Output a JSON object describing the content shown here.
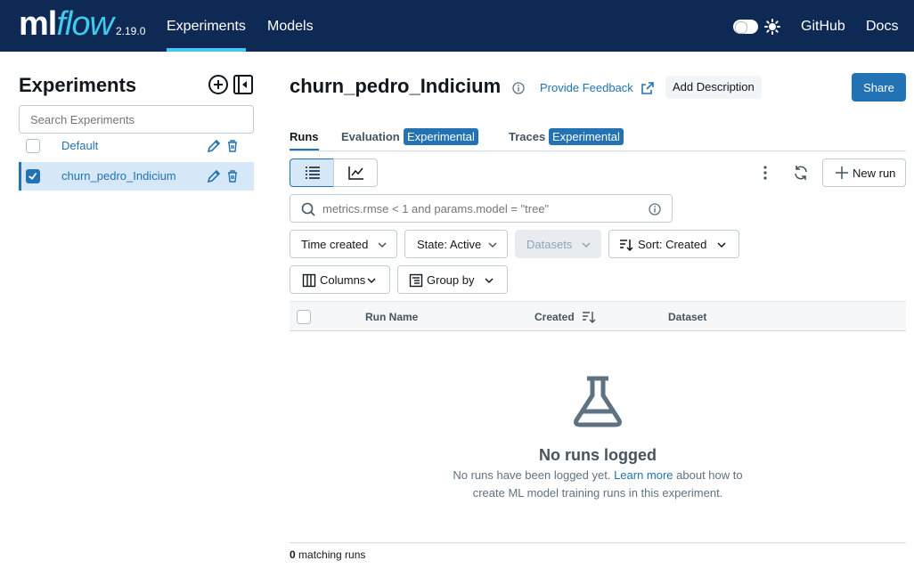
{
  "topbar": {
    "logo_ml": "ml",
    "logo_flow": "flow",
    "version": "2.19.0",
    "tabs": [
      {
        "label": "Experiments"
      },
      {
        "label": "Models"
      }
    ],
    "links": [
      {
        "label": "GitHub"
      },
      {
        "label": "Docs"
      }
    ],
    "bg_color": "#0e2a54",
    "accent_color": "#43c9ed"
  },
  "sidebar": {
    "title": "Experiments",
    "search_placeholder": "Search Experiments",
    "items": [
      {
        "label": "Default",
        "checked": false
      },
      {
        "label": "churn_pedro_Indicium",
        "checked": true
      }
    ]
  },
  "header": {
    "title": "churn_pedro_Indicium",
    "feedback_label": "Provide Feedback",
    "add_description_label": "Add Description",
    "share_label": "Share"
  },
  "tabs": [
    {
      "label": "Runs",
      "badge": ""
    },
    {
      "label": "Evaluation",
      "badge": "Experimental"
    },
    {
      "label": "Traces",
      "badge": "Experimental"
    }
  ],
  "toolbar": {
    "new_run_label": "New run",
    "search_placeholder": "metrics.rmse < 1 and params.model = \"tree\""
  },
  "filters": {
    "time_created": "Time created",
    "state_prefix": "State:",
    "state_value": "Active",
    "datasets": "Datasets",
    "sort_prefix": "Sort:",
    "sort_value": "Created",
    "columns": "Columns",
    "group_by": "Group by"
  },
  "table": {
    "columns": [
      "Run Name",
      "Created",
      "Dataset"
    ]
  },
  "empty_state": {
    "title": "No runs logged",
    "desc_prefix": "No runs have been logged yet. ",
    "link": "Learn more",
    "desc_suffix": " about how to create ML model training runs in this experiment."
  },
  "footer": {
    "count": "0",
    "label": " matching runs"
  },
  "colors": {
    "primary": "#2272b4",
    "selected_bg": "#d6e8f7"
  }
}
